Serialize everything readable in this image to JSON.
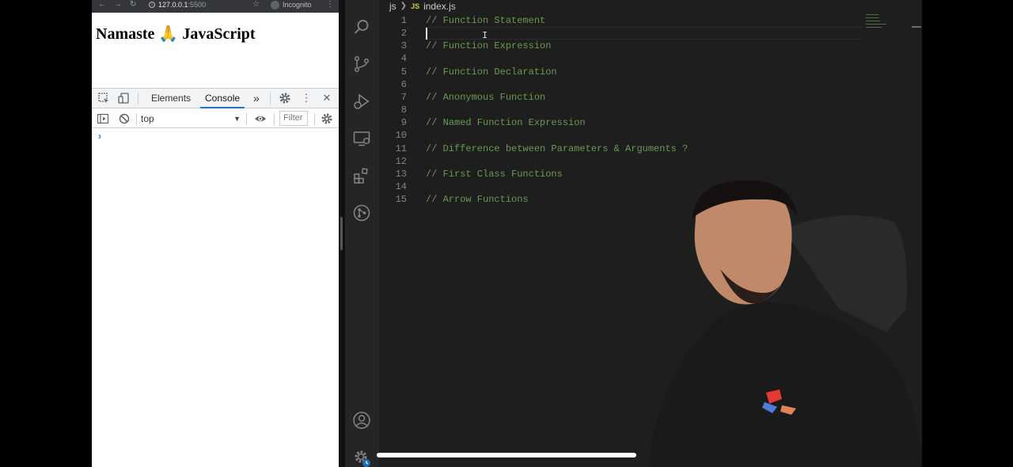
{
  "browser": {
    "url_host": "127.0.0.1",
    "url_port": ":5500",
    "incognito_label": "Incognito",
    "page_heading": "Namaste 🙏 JavaScript",
    "nav_icons": [
      "back-icon",
      "forward-icon",
      "reload-icon"
    ]
  },
  "devtools": {
    "tabs": [
      {
        "label": "Elements",
        "active": false
      },
      {
        "label": "Console",
        "active": true
      }
    ],
    "more_tabs_label": "»",
    "context_select_value": "top",
    "filter_placeholder": "Filter",
    "console_prompt": "›"
  },
  "vscode": {
    "breadcrumb_folder": "js",
    "breadcrumb_file_badge": "JS",
    "breadcrumb_file": "index.js",
    "activity_icons": [
      "explorer-search-icon",
      "source-control-icon",
      "run-debug-icon",
      "remote-explorer-icon",
      "extensions-icon",
      "git-graph-icon",
      "account-icon",
      "settings-gear-icon"
    ],
    "current_line": 2,
    "lines": [
      {
        "n": "1",
        "text": "// Function Statement"
      },
      {
        "n": "2",
        "text": ""
      },
      {
        "n": "3",
        "text": "// Function Expression"
      },
      {
        "n": "4",
        "text": ""
      },
      {
        "n": "5",
        "text": "// Function Declaration"
      },
      {
        "n": "6",
        "text": ""
      },
      {
        "n": "7",
        "text": "// Anonymous Function"
      },
      {
        "n": "8",
        "text": ""
      },
      {
        "n": "9",
        "text": "// Named Function Expression"
      },
      {
        "n": "10",
        "text": ""
      },
      {
        "n": "11",
        "text": "// Difference between Parameters & Arguments ?"
      },
      {
        "n": "12",
        "text": ""
      },
      {
        "n": "13",
        "text": "// First Class Functions"
      },
      {
        "n": "14",
        "text": ""
      },
      {
        "n": "15",
        "text": "// Arrow Functions"
      }
    ]
  },
  "colors": {
    "comment": "#6a9955",
    "editor_bg": "#1e1e1e",
    "activity_bg": "#252526",
    "devtools_accent": "#1a73e8"
  },
  "video": {
    "progress_fraction": 0.4
  }
}
